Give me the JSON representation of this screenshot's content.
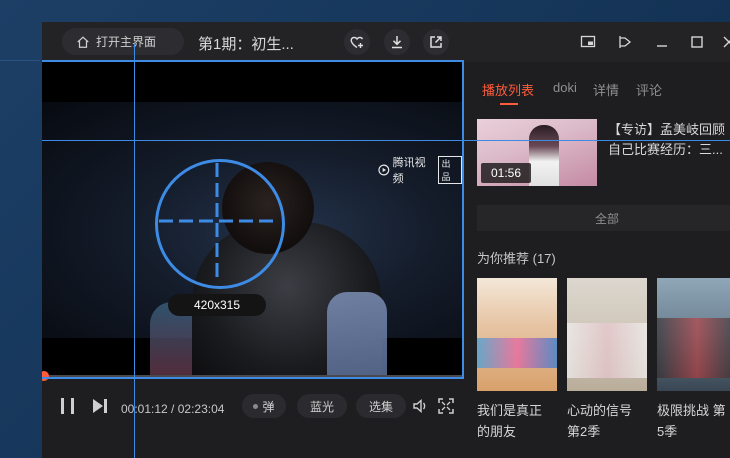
{
  "app": {
    "home_button": "打开主界面",
    "episode_title": "第1期：初生..."
  },
  "player": {
    "watermark": "腾讯视频",
    "watermark_badge": "出品",
    "capture_size": "420x315",
    "time_current": "00:01:12",
    "time_separator": " / ",
    "time_total": "02:23:04",
    "progress": 0.008,
    "danmaku_label": "弹",
    "quality_label": "蓝光",
    "episodes_label": "选集"
  },
  "sidebar": {
    "tabs": [
      {
        "label": "播放列表",
        "active": true
      },
      {
        "label": "doki",
        "active": false
      },
      {
        "label": "详情",
        "active": false
      },
      {
        "label": "评论",
        "active": false
      }
    ],
    "featured": {
      "title_line1": "【专访】孟美岐回顾",
      "title_line2": "自己比赛经历：三...",
      "duration": "01:56"
    },
    "all_button": "全部",
    "recommend_heading": "为你推荐 (17)",
    "recommendations": [
      {
        "line1": "我们是真正",
        "line2": "的朋友"
      },
      {
        "line1": "心动的信号",
        "line2": "第2季"
      },
      {
        "line1": "极限挑战 第",
        "line2": "5季"
      }
    ]
  },
  "colors": {
    "accent": "#ff5b3c",
    "selection": "#3d8be5",
    "window_bg": "#1e1e21"
  },
  "icons": {
    "home": "home-icon",
    "favorite": "heart-plus-icon",
    "download": "download-icon",
    "share": "share-icon",
    "mini_mode": "mini-mode-icon",
    "pin": "pin-icon",
    "minimize": "minimize-icon",
    "maximize": "maximize-icon",
    "close": "close-icon",
    "pause": "pause-icon",
    "next": "next-icon",
    "volume": "volume-icon",
    "fullscreen": "fullscreen-icon"
  }
}
